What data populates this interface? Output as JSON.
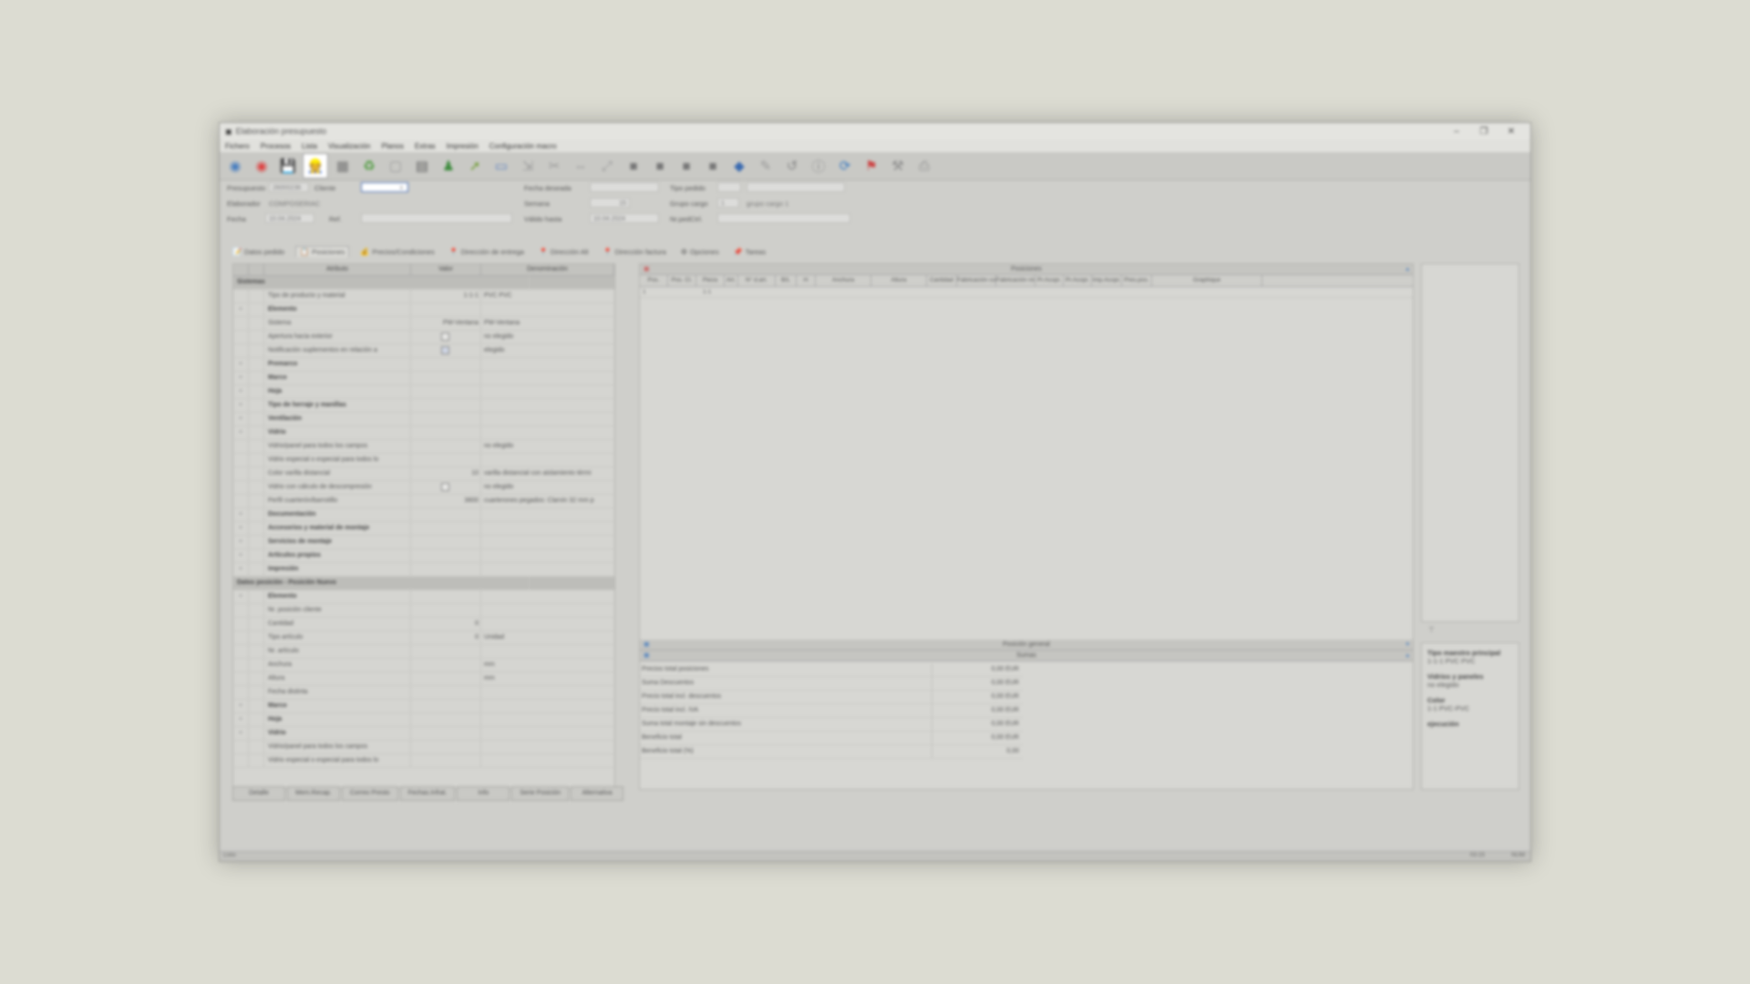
{
  "window": {
    "title": "Elaboración presupuesto",
    "controls": [
      "–",
      "❐",
      "✕"
    ]
  },
  "menu": [
    "Fichero",
    "Procesos",
    "Lista",
    "Visualización",
    "Planos",
    "Extras",
    "Impresión",
    "Configuración macro"
  ],
  "toolbar": [
    "info",
    "record",
    "save",
    "user-pencil",
    "boxes",
    "recycle",
    "doc",
    "grid",
    "users",
    "arrow",
    "window",
    "import",
    "cut",
    "move",
    "scale",
    "square1",
    "square2",
    "square3",
    "square4",
    "cube",
    "edit",
    "undo",
    "info2",
    "refresh",
    "map",
    "tool",
    "print"
  ],
  "fields": {
    "presupuesto_label": "Presupuesto",
    "presupuesto_value": "26000236",
    "cliente_label": "Cliente",
    "cliente_value": "",
    "elaborador_label": "Elaborador",
    "elaborador_value": "COMPOSERIAC",
    "fecha_label": "Fecha",
    "fecha_value": "10.04.2024",
    "ref_label": "Ref.",
    "ref_value": "",
    "fecha_deseada_label": "Fecha deseada",
    "fecha_deseada_value": "",
    "tipo_pedido_label": "Tipo pedido",
    "tipo_pedido_value": "",
    "semana_label": "Semana",
    "semana_value": "15",
    "grupo_cargo_label": "Grupo cargo",
    "grupo_cargo_value": "1",
    "grupo_cargo_desc": "grupo cargo 1",
    "valido_label": "Válido hasta",
    "valido_value": "10.04.2024",
    "pedido_label": "Nr.pedCtrl.",
    "pedido_value": ""
  },
  "tabs": [
    {
      "label": "Datos pedido",
      "icon": "📝"
    },
    {
      "label": "Posiciones",
      "icon": "📋",
      "selected": true
    },
    {
      "label": "Precios/Condiciones",
      "icon": "💰"
    },
    {
      "label": "Dirección de entrega",
      "icon": "📍"
    },
    {
      "label": "Dirección Alt",
      "icon": "📍"
    },
    {
      "label": "Dirección factura",
      "icon": "📍"
    },
    {
      "label": "Opciones",
      "icon": "⚙"
    },
    {
      "label": "Tareas",
      "icon": "📌"
    }
  ],
  "attributes": {
    "headers": [
      "Atributo",
      "Valor",
      "Denominación"
    ],
    "rows": [
      {
        "type": "section",
        "name": "Sistemas",
        "value": "",
        "desc": ""
      },
      {
        "type": "item",
        "name": "Tipo de producto y material",
        "value": "1-1-1",
        "desc": "PVC PVC"
      },
      {
        "type": "group",
        "name": "Elemento",
        "value": "",
        "desc": ""
      },
      {
        "type": "item",
        "name": "Sistema",
        "value": "PW-Ventana",
        "desc": "PW-Ventana"
      },
      {
        "type": "item",
        "name": "Apertura hacia exterior",
        "value": "☐",
        "desc": "no elegido"
      },
      {
        "type": "item",
        "name": "Notificación suplementos en relación a",
        "value": "☑",
        "desc": "elegido"
      },
      {
        "type": "group",
        "name": "Premarco",
        "value": "",
        "desc": ""
      },
      {
        "type": "group",
        "name": "Marco",
        "value": "",
        "desc": ""
      },
      {
        "type": "group",
        "name": "Hoja",
        "value": "",
        "desc": ""
      },
      {
        "type": "group",
        "name": "Tipo de herraje y manillas",
        "value": "",
        "desc": ""
      },
      {
        "type": "group",
        "name": "Ventilación",
        "value": "",
        "desc": ""
      },
      {
        "type": "group",
        "name": "Vidrio",
        "value": "",
        "desc": ""
      },
      {
        "type": "item",
        "name": "Vidrio/panel para todos los campos",
        "value": "",
        "desc": "no elegido"
      },
      {
        "type": "item",
        "name": "Vidrio especial o especial para todos lo",
        "value": "",
        "desc": ""
      },
      {
        "type": "item",
        "name": "Color varilla distancial",
        "value": "10",
        "desc": "varilla distancial con aislamiento térmi"
      },
      {
        "type": "item",
        "name": "Vidrio con cálculo de descompresión",
        "value": "☐",
        "desc": "no elegido"
      },
      {
        "type": "item",
        "name": "Perfil cuarterón/barrotillo",
        "value": "3800",
        "desc": "cuarterones pegados: Clarvin 32 mm p"
      },
      {
        "type": "group",
        "name": "Documentación",
        "value": "",
        "desc": ""
      },
      {
        "type": "group",
        "name": "Accesorios y material de montaje",
        "value": "",
        "desc": ""
      },
      {
        "type": "group",
        "name": "Servicios de montaje",
        "value": "",
        "desc": ""
      },
      {
        "type": "group",
        "name": "Artículos propios",
        "value": "",
        "desc": ""
      },
      {
        "type": "group",
        "name": "Impresión",
        "value": "",
        "desc": ""
      },
      {
        "type": "section",
        "name": "Datos posición - Posición Nuevo",
        "value": "",
        "desc": ""
      },
      {
        "type": "group",
        "name": "Elemento",
        "value": "",
        "desc": ""
      },
      {
        "type": "item",
        "name": "Nr. posición cliente",
        "value": "",
        "desc": ""
      },
      {
        "type": "item",
        "name": "Cantidad",
        "value": "0",
        "desc": ""
      },
      {
        "type": "item",
        "name": "Tipo artículo",
        "value": "0",
        "desc": "Unidad"
      },
      {
        "type": "item",
        "name": "Nr. artículo",
        "value": "",
        "desc": ""
      },
      {
        "type": "item",
        "name": "Anchura",
        "value": "",
        "desc": "mm"
      },
      {
        "type": "item",
        "name": "Altura",
        "value": "",
        "desc": "mm"
      },
      {
        "type": "item",
        "name": "Fecha distinta",
        "value": "",
        "desc": ""
      },
      {
        "type": "group",
        "name": "Marco",
        "value": "",
        "desc": ""
      },
      {
        "type": "group",
        "name": "Hoja",
        "value": "",
        "desc": ""
      },
      {
        "type": "group",
        "name": "Vidrio",
        "value": "",
        "desc": ""
      },
      {
        "type": "item",
        "name": "Vidrio/panel para todos los campos",
        "value": "",
        "desc": ""
      },
      {
        "type": "item",
        "name": "Vidrio especial o especial para todos lo",
        "value": "",
        "desc": ""
      }
    ]
  },
  "positions": {
    "title": "Posiciones",
    "columns": [
      "Pos.",
      "Pos. Cl.",
      "Pieza",
      "Art.",
      "N° d.art.",
      "B/L",
      "H",
      "Anchura",
      "Altura",
      "Cantidad",
      "Fabricación contar",
      "Fabricación nivel",
      "Pr.Acopi.",
      "Pr.Acopi.",
      "Imp.Acopi.",
      "Pres.pos.",
      "Graphique"
    ],
    "rows": [
      [
        "1",
        "",
        "1-1",
        ""
      ]
    ]
  },
  "posgeneral": "Posición general",
  "sumas": "Sumas",
  "sums": [
    {
      "label": "Precios total posiciones",
      "value": "0,00 EUR"
    },
    {
      "label": "Suma Descuentos",
      "value": "0,00 EUR"
    },
    {
      "label": "Precio total incl. descuentos",
      "value": "0,00 EUR"
    },
    {
      "label": "Precio total incl. IVA",
      "value": "0,00 EUR"
    },
    {
      "label": "Suma total montaje sin descuentos",
      "value": "0,00 EUR"
    },
    {
      "label": "Beneficio total",
      "value": "0,00 EUR"
    },
    {
      "label": "Beneficio total (%)",
      "value": "0,00"
    }
  ],
  "preview": {
    "h1": "Tipo maestro principal",
    "v1": "1-1-1 PVC PVC",
    "h2": "Vidrios y paneles",
    "v2": "no elegido",
    "h3": "Color",
    "v3": "1-1  PVC-PVC",
    "h4": "ejecución"
  },
  "buttons": [
    "Detalle",
    "Mem.Recap.",
    "Correo Presto",
    "Fechas.Infrat.",
    "Info",
    "Serie Posición",
    "Alternativa"
  ],
  "status": {
    "left": "Listo",
    "right1": "03:15",
    "right2": "NUM"
  }
}
